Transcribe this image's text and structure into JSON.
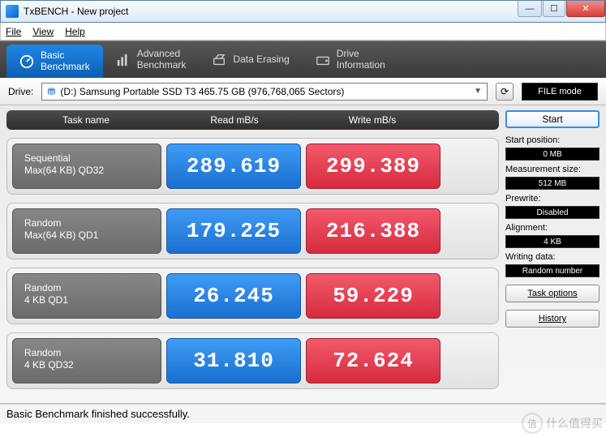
{
  "window": {
    "title": "TxBENCH - New project"
  },
  "menu": {
    "file": "File",
    "view": "View",
    "help": "Help"
  },
  "tabs": [
    {
      "line1": "Basic",
      "line2": "Benchmark",
      "icon": "gauge-icon"
    },
    {
      "line1": "Advanced",
      "line2": "Benchmark",
      "icon": "bars-icon"
    },
    {
      "line1": "Data Erasing",
      "line2": "",
      "icon": "erase-icon"
    },
    {
      "line1": "Drive",
      "line2": "Information",
      "icon": "drive-icon"
    }
  ],
  "drive": {
    "label": "Drive:",
    "selected": "(D:) Samsung Portable SSD T3  465.75 GB (976,768,065 Sectors)",
    "mode": "FILE mode"
  },
  "headers": {
    "task": "Task name",
    "read": "Read mB/s",
    "write": "Write mB/s"
  },
  "rows": [
    {
      "name1": "Sequential",
      "name2": "Max(64 KB) QD32",
      "read": "289.619",
      "write": "299.389"
    },
    {
      "name1": "Random",
      "name2": "Max(64 KB) QD1",
      "read": "179.225",
      "write": "216.388"
    },
    {
      "name1": "Random",
      "name2": "4 KB QD1",
      "read": "26.245",
      "write": "59.229"
    },
    {
      "name1": "Random",
      "name2": "4 KB QD32",
      "read": "31.810",
      "write": "72.624"
    }
  ],
  "side": {
    "start": "Start",
    "start_pos_label": "Start position:",
    "start_pos": "0 MB",
    "meas_label": "Measurement size:",
    "meas": "512 MB",
    "prewrite_label": "Prewrite:",
    "prewrite": "Disabled",
    "align_label": "Alignment:",
    "align": "4 KB",
    "wdata_label": "Writing data:",
    "wdata": "Random number",
    "taskopt": "Task options",
    "history": "History"
  },
  "status": "Basic Benchmark finished successfully.",
  "watermark": "什么值得买"
}
